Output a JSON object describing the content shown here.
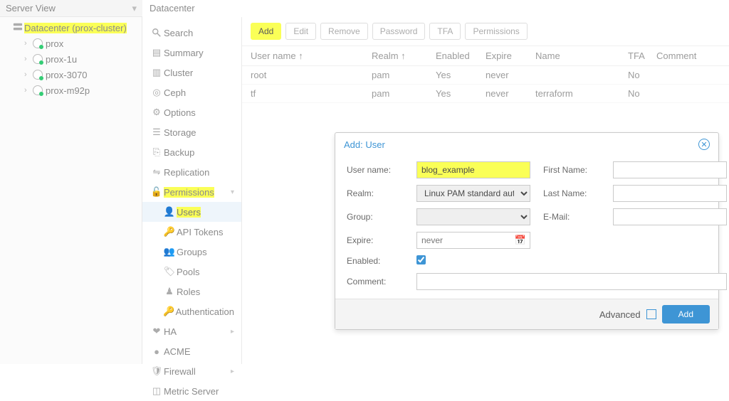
{
  "server_view_header": "Server View",
  "tree": {
    "root": "Datacenter (prox-cluster)",
    "nodes": [
      "prox",
      "prox-1u",
      "prox-3070",
      "prox-m92p"
    ]
  },
  "content_title": "Datacenter",
  "menu": {
    "search": "Search",
    "summary": "Summary",
    "cluster": "Cluster",
    "ceph": "Ceph",
    "options": "Options",
    "storage": "Storage",
    "backup": "Backup",
    "replication": "Replication",
    "permissions": "Permissions",
    "users": "Users",
    "api_tokens": "API Tokens",
    "groups": "Groups",
    "pools": "Pools",
    "roles": "Roles",
    "authentication": "Authentication",
    "ha": "HA",
    "acme": "ACME",
    "firewall": "Firewall",
    "metric": "Metric Server"
  },
  "toolbar": {
    "add": "Add",
    "edit": "Edit",
    "remove": "Remove",
    "password": "Password",
    "tfa": "TFA",
    "permissions": "Permissions"
  },
  "table": {
    "headers": {
      "user": "User name ↑",
      "realm": "Realm ↑",
      "enabled": "Enabled",
      "expire": "Expire",
      "name": "Name",
      "tfa": "TFA",
      "comment": "Comment"
    },
    "rows": [
      {
        "user": "root",
        "realm": "pam",
        "enabled": "Yes",
        "expire": "never",
        "name": "",
        "tfa": "No",
        "comment": ""
      },
      {
        "user": "tf",
        "realm": "pam",
        "enabled": "Yes",
        "expire": "never",
        "name": "terraform",
        "tfa": "No",
        "comment": ""
      }
    ]
  },
  "modal": {
    "title": "Add: User",
    "labels": {
      "username": "User name:",
      "realm": "Realm:",
      "group": "Group:",
      "expire": "Expire:",
      "enabled": "Enabled:",
      "comment": "Comment:",
      "firstname": "First Name:",
      "lastname": "Last Name:",
      "email": "E-Mail:"
    },
    "values": {
      "username": "blog_example",
      "realm_options": [
        "Linux PAM standard authentication"
      ],
      "realm_selected": "Linux PAM standard aut",
      "group": "",
      "expire_placeholder": "never",
      "enabled": true,
      "firstname": "",
      "lastname": "",
      "email": "",
      "comment": ""
    },
    "footer": {
      "advanced": "Advanced",
      "add": "Add"
    }
  }
}
